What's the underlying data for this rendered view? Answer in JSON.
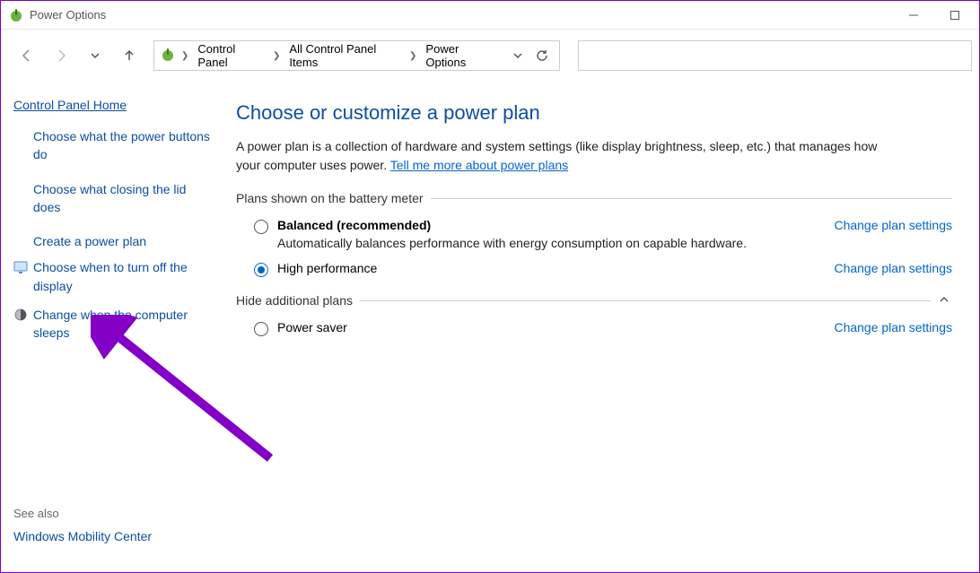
{
  "window": {
    "title": "Power Options"
  },
  "breadcrumb": {
    "items": [
      "Control Panel",
      "All Control Panel Items",
      "Power Options"
    ]
  },
  "sidebar": {
    "home": "Control Panel Home",
    "links": [
      "Choose what the power buttons do",
      "Choose what closing the lid does",
      "Create a power plan",
      "Choose when to turn off the display",
      "Change when the computer sleeps"
    ],
    "seealso_label": "See also",
    "seealso_links": [
      "Windows Mobility Center"
    ]
  },
  "main": {
    "heading": "Choose or customize a power plan",
    "intro_prefix": "A power plan is a collection of hardware and system settings (like display brightness, sleep, etc.) that manages how your computer uses power. ",
    "intro_link": "Tell me more about power plans",
    "section1_label": "Plans shown on the battery meter",
    "section2_label": "Hide additional plans",
    "change_link": "Change plan settings",
    "plans": [
      {
        "name": "Balanced (recommended)",
        "desc": "Automatically balances performance with energy consumption on capable hardware.",
        "selected": false
      },
      {
        "name": "High performance",
        "desc": "",
        "selected": true
      }
    ],
    "additional_plans": [
      {
        "name": "Power saver",
        "desc": "",
        "selected": false
      }
    ]
  }
}
